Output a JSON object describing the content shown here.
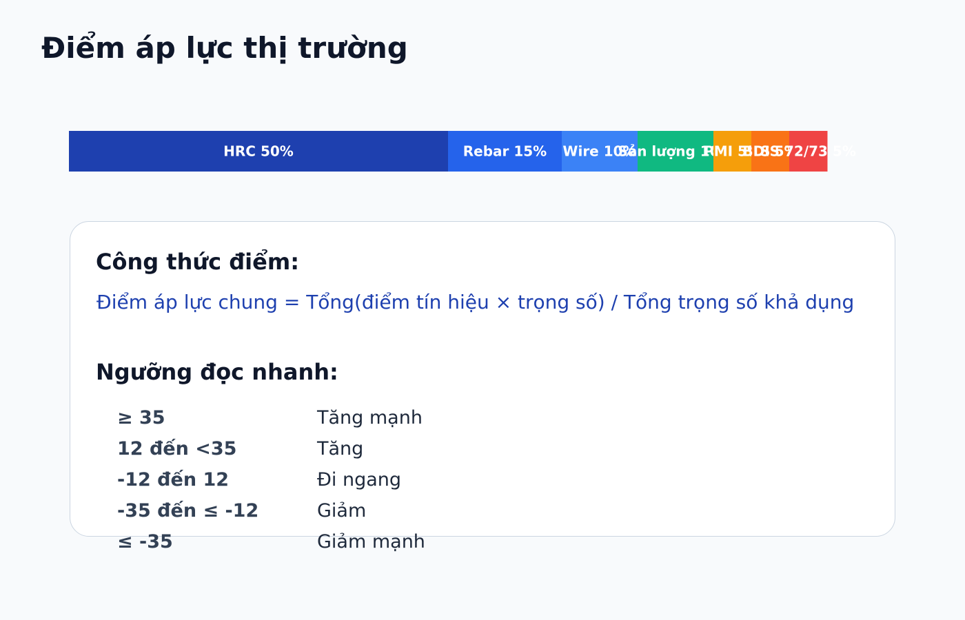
{
  "page": {
    "title": "Điểm áp lực thị trường"
  },
  "chart_data": {
    "type": "bar",
    "orientation": "horizontal",
    "stacked": true,
    "total": 100,
    "segments": [
      {
        "label": "HRC 50%",
        "value": 50,
        "color": "#1e40af"
      },
      {
        "label": "Rebar 15%",
        "value": 15,
        "color": "#2563eb"
      },
      {
        "label": "Wire 10%",
        "value": 10,
        "color": "#3b82f6"
      },
      {
        "label": "Sản lượng 10%",
        "value": 10,
        "color": "#10b981"
      },
      {
        "label": "PMI 5%",
        "value": 5,
        "color": "#f59e0b"
      },
      {
        "label": "BDI 5%",
        "value": 5,
        "color": "#f97316"
      },
      {
        "label": "SS 72/73 5%",
        "value": 5,
        "color": "#ef4444"
      }
    ]
  },
  "formula": {
    "heading": "Công thức điểm:",
    "text": "Điểm áp lực chung = Tổng(điểm tín hiệu × trọng số) / Tổng trọng số khả dụng"
  },
  "thresholds": {
    "heading": "Ngưỡng đọc nhanh:",
    "rows": [
      {
        "range": "≥ 35",
        "meaning": "Tăng mạnh"
      },
      {
        "range": "12 đến <35",
        "meaning": "Tăng"
      },
      {
        "range": "-12 đến 12",
        "meaning": "Đi ngang"
      },
      {
        "range": "-35 đến ≤ -12",
        "meaning": "Giảm"
      },
      {
        "range": "≤ -35",
        "meaning": "Giảm mạnh"
      }
    ]
  }
}
